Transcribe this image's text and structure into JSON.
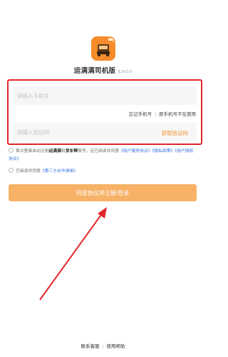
{
  "app": {
    "name": "运满满司机版",
    "version": "8.24.2.0",
    "logo_icon": "truck-icon",
    "brand_color": "#f58b2a"
  },
  "form": {
    "phone_placeholder": "请输入手机号",
    "forgot_phone": "忘记手机号",
    "link_separator": "|",
    "phone_not_in_use": "原手机号不在使用",
    "code_placeholder": "请输入验证码",
    "get_code": "获取验证码"
  },
  "agreement": {
    "line1_prefix": "首次登录自动注册",
    "line1_brand1": "运满满",
    "line1_and": "和",
    "line1_brand2": "货车帮",
    "line1_mid": "账号，且已阅读并同意",
    "user_service_agreement": "《用户服务协议》",
    "privacy_policy": "《隐私政策》",
    "user_authorization": "《用户授权协议》",
    "line2_prefix": "已阅读并同意",
    "third_party_list": "《第三方合作清单》"
  },
  "submit_label": "同意协议并注册/登录",
  "annotation": {
    "box_color": "#e3262b"
  },
  "footer": {
    "contact": "联系客服",
    "separator": "|",
    "help": "使用帮助"
  }
}
